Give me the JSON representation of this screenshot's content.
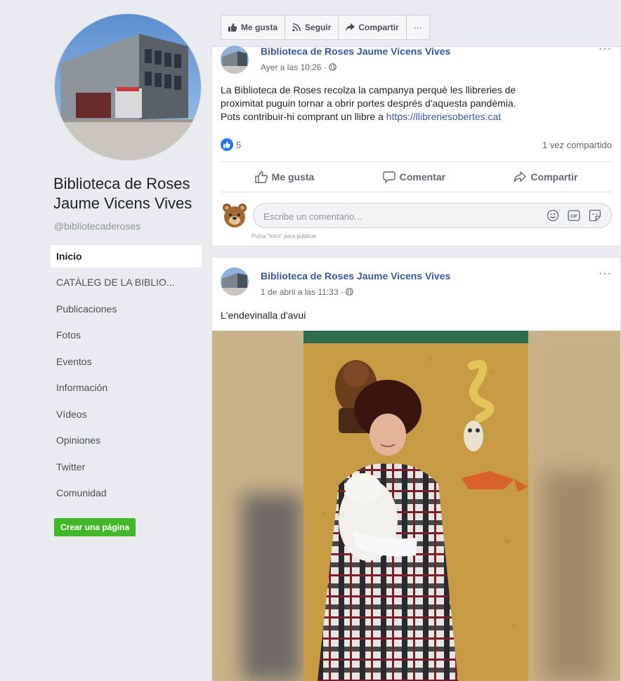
{
  "page": {
    "name": "Biblioteca de Roses Jaume Vicens Vives",
    "handle": "@bibliotecaderoses"
  },
  "nav": {
    "items": [
      {
        "label": "Inicio",
        "active": true
      },
      {
        "label": "CATÀLEG DE LA BIBLIO..."
      },
      {
        "label": "Publicaciones"
      },
      {
        "label": "Fotos"
      },
      {
        "label": "Eventos"
      },
      {
        "label": "Información"
      },
      {
        "label": "Vídeos"
      },
      {
        "label": "Opiniones"
      },
      {
        "label": "Twitter"
      },
      {
        "label": "Comunidad"
      }
    ],
    "create_page": "Crear una página"
  },
  "actionbar": {
    "like": "Me gusta",
    "follow": "Seguir",
    "share": "Compartir",
    "more": "···"
  },
  "posts": [
    {
      "author": "Biblioteca de Roses Jaume Vicens Vives",
      "time": "Ayer a las 10:26 ·",
      "text_line1": "La Biblioteca de Roses recolza la campanya perquè les llibreries de",
      "text_line2": "proximitat puguin tornar a obrir portes després d'aquesta pandèmia.",
      "text_line3": "Pots contribuir-hi comprant un llibre a",
      "link": "https://llibreriesobertes.cat",
      "reactions_count": "5",
      "shares": "1 vez compartido",
      "actions": {
        "like": "Me gusta",
        "comment": "Comentar",
        "share": "Compartir"
      },
      "comment_placeholder": "Escribe un comentario...",
      "comment_hint": "Pulsa \"Intro\" para publicar."
    },
    {
      "author": "Biblioteca de Roses Jaume Vicens Vives",
      "time": "1 de abril a las 11:33 ·",
      "text": "L'endevinalla d'avui"
    }
  ],
  "colors": {
    "background": "#e9ebee",
    "link": "#385898",
    "create_button": "#42b72a",
    "like_blue": "#2078f4"
  }
}
